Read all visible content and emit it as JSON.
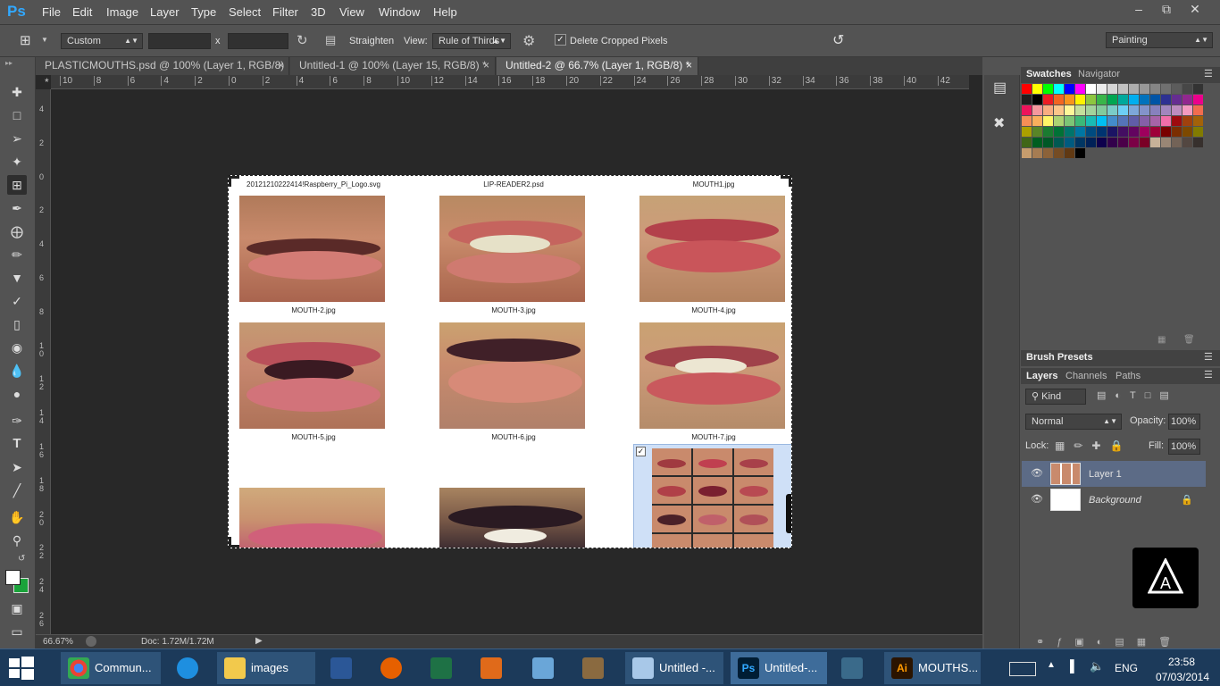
{
  "app": {
    "logo": "Ps",
    "menu": [
      "File",
      "Edit",
      "Image",
      "Layer",
      "Type",
      "Select",
      "Filter",
      "3D",
      "View",
      "Window",
      "Help"
    ]
  },
  "options": {
    "ratio": "Custom",
    "x_sep": "x",
    "straighten": "Straighten",
    "view_label": "View:",
    "view_value": "Rule of Thirds",
    "delete_cropped": "Delete Cropped Pixels",
    "workspace": "Painting"
  },
  "tabs": [
    {
      "label": "PLASTICMOUTHS.psd @ 100% (Layer 1, RGB/8) *",
      "active": false
    },
    {
      "label": "Untitled-1 @ 100% (Layer 15, RGB/8) *",
      "active": false
    },
    {
      "label": "Untitled-2 @ 66.7% (Layer 1, RGB/8) *",
      "active": true
    }
  ],
  "tab_close": "×",
  "ruler_top": [
    "10",
    "8",
    "6",
    "4",
    "2",
    "0",
    "2",
    "4",
    "6",
    "8",
    "10",
    "12",
    "14",
    "16",
    "18",
    "20",
    "22",
    "24",
    "26",
    "28",
    "30",
    "32",
    "34",
    "36",
    "38",
    "40",
    "42"
  ],
  "ruler_left": [
    "4",
    "2",
    "0",
    "2",
    "4",
    "6",
    "8",
    "1 0",
    "1 2",
    "1 4",
    "1 6",
    "1 8",
    "2 0",
    "2 2",
    "2 4",
    "2 6"
  ],
  "document": {
    "labels_top": [
      "20121210222414!Raspberry_Pi_Logo.svg",
      "LIP-READER2.psd",
      "MOUTH1.jpg"
    ],
    "row_labels": [
      [
        "MOUTH-2.jpg",
        "MOUTH-3.jpg",
        "MOUTH-4.jpg"
      ],
      [
        "MOUTH-5.jpg",
        "MOUTH-6.jpg",
        "MOUTH-7.jpg"
      ]
    ],
    "checkbox": "✓"
  },
  "status": {
    "zoom": "66.67%",
    "doc": "Doc: 1.72M/1.72M"
  },
  "panels": {
    "swatches_tab": "Swatches",
    "navigator_tab": "Navigator",
    "brush_presets": "Brush Presets",
    "layers_tabs": [
      "Layers",
      "Channels",
      "Paths"
    ],
    "kind": "Kind",
    "blend": "Normal",
    "opacity_label": "Opacity:",
    "opacity": "100%",
    "lock_label": "Lock:",
    "fill_label": "Fill:",
    "fill": "100%",
    "layers": [
      {
        "name": "Layer 1",
        "selected": true
      },
      {
        "name": "Background",
        "selected": false,
        "locked": true
      }
    ]
  },
  "swatch_colors": [
    "#ff0000",
    "#ffff00",
    "#00ff00",
    "#00ffff",
    "#0000ff",
    "#ff00ff",
    "#ffffff",
    "#ebebeb",
    "#d6d6d6",
    "#c2c2c2",
    "#adadad",
    "#999999",
    "#858585",
    "#707070",
    "#5c5c5c",
    "#474747",
    "#333333",
    "#1f1f1f",
    "#000000",
    "#ed1c24",
    "#f26522",
    "#f7941d",
    "#fff200",
    "#8dc63f",
    "#39b54a",
    "#00a651",
    "#00a99d",
    "#00aeef",
    "#0072bc",
    "#0054a6",
    "#2e3192",
    "#662d91",
    "#92278f",
    "#ec008c",
    "#ed145b",
    "#f5989d",
    "#f9ad81",
    "#fdc68a",
    "#fff799",
    "#c4df9b",
    "#a3d39c",
    "#82ca9c",
    "#7accc8",
    "#6dcff6",
    "#7da7d9",
    "#8393ca",
    "#8781bd",
    "#a186be",
    "#bd8cbf",
    "#f49ac1",
    "#f26c4f",
    "#f68e56",
    "#fbaf5d",
    "#fff568",
    "#acd373",
    "#7cc576",
    "#3bb878",
    "#1abbb4",
    "#00bff3",
    "#438ccb",
    "#5574b9",
    "#605ca8",
    "#855fa8",
    "#a763a8",
    "#f06ea9",
    "#9e0b0f",
    "#a0410d",
    "#a36209",
    "#aba000",
    "#598527",
    "#1a7b30",
    "#007236",
    "#00746b",
    "#0076a3",
    "#004b80",
    "#003471",
    "#1b1464",
    "#440e62",
    "#630460",
    "#9e005d",
    "#9e0039",
    "#790000",
    "#7b2e00",
    "#7d4900",
    "#827b00",
    "#406618",
    "#005e20",
    "#005826",
    "#005952",
    "#005b7f",
    "#003663",
    "#002157",
    "#0d004c",
    "#32004b",
    "#4b0049",
    "#7b0046",
    "#7a0026",
    "#c7b299",
    "#998675",
    "#736357",
    "#534741",
    "#37302d",
    "#c69c6d",
    "#a67c52",
    "#8c6239",
    "#754c24",
    "#603913",
    "#000000"
  ],
  "taskbar": {
    "items": [
      "Commun...",
      "",
      "images",
      "",
      "",
      "",
      "",
      "",
      "",
      "Untitled -...",
      "Untitled-...",
      "",
      "MOUTHS..."
    ],
    "lang": "ENG",
    "time": "23:58",
    "date": "07/03/2014"
  },
  "colors": {
    "fg": "#ffffff",
    "bg": "#1aa33a",
    "accent": "#31a8ff"
  }
}
